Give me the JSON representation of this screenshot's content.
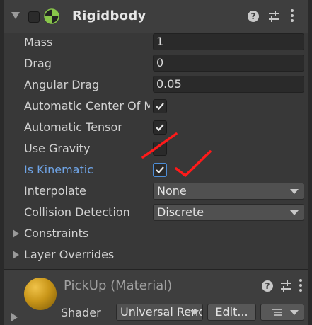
{
  "component": {
    "title": "Rigidbody",
    "help_glyph": "?"
  },
  "properties": {
    "mass": {
      "label": "Mass",
      "value": "1"
    },
    "drag": {
      "label": "Drag",
      "value": "0"
    },
    "angular_drag": {
      "label": "Angular Drag",
      "value": "0.05"
    },
    "automatic_center_of_mass": {
      "label": "Automatic Center Of Mass",
      "checked": true
    },
    "automatic_tensor": {
      "label": "Automatic Tensor",
      "checked": true
    },
    "use_gravity": {
      "label": "Use Gravity",
      "checked": false
    },
    "is_kinematic": {
      "label": "Is Kinematic",
      "checked": true
    },
    "interpolate": {
      "label": "Interpolate",
      "value": "None"
    },
    "collision_detection": {
      "label": "Collision Detection",
      "value": "Discrete"
    }
  },
  "foldouts": {
    "constraints": "Constraints",
    "layer_overrides": "Layer Overrides"
  },
  "material": {
    "title": "PickUp (Material)",
    "shader_label": "Shader",
    "shader_value": "Universal Render Pipeline/Lit",
    "edit_label": "Edit...",
    "help_glyph": "?"
  },
  "colors": {
    "background": "#383838",
    "header": "#3e3e3e",
    "field": "#2a2a2a",
    "highlight_label": "#6fa4e6",
    "annotation_red": "#ff1a1a",
    "material_ball": "#c99619"
  }
}
